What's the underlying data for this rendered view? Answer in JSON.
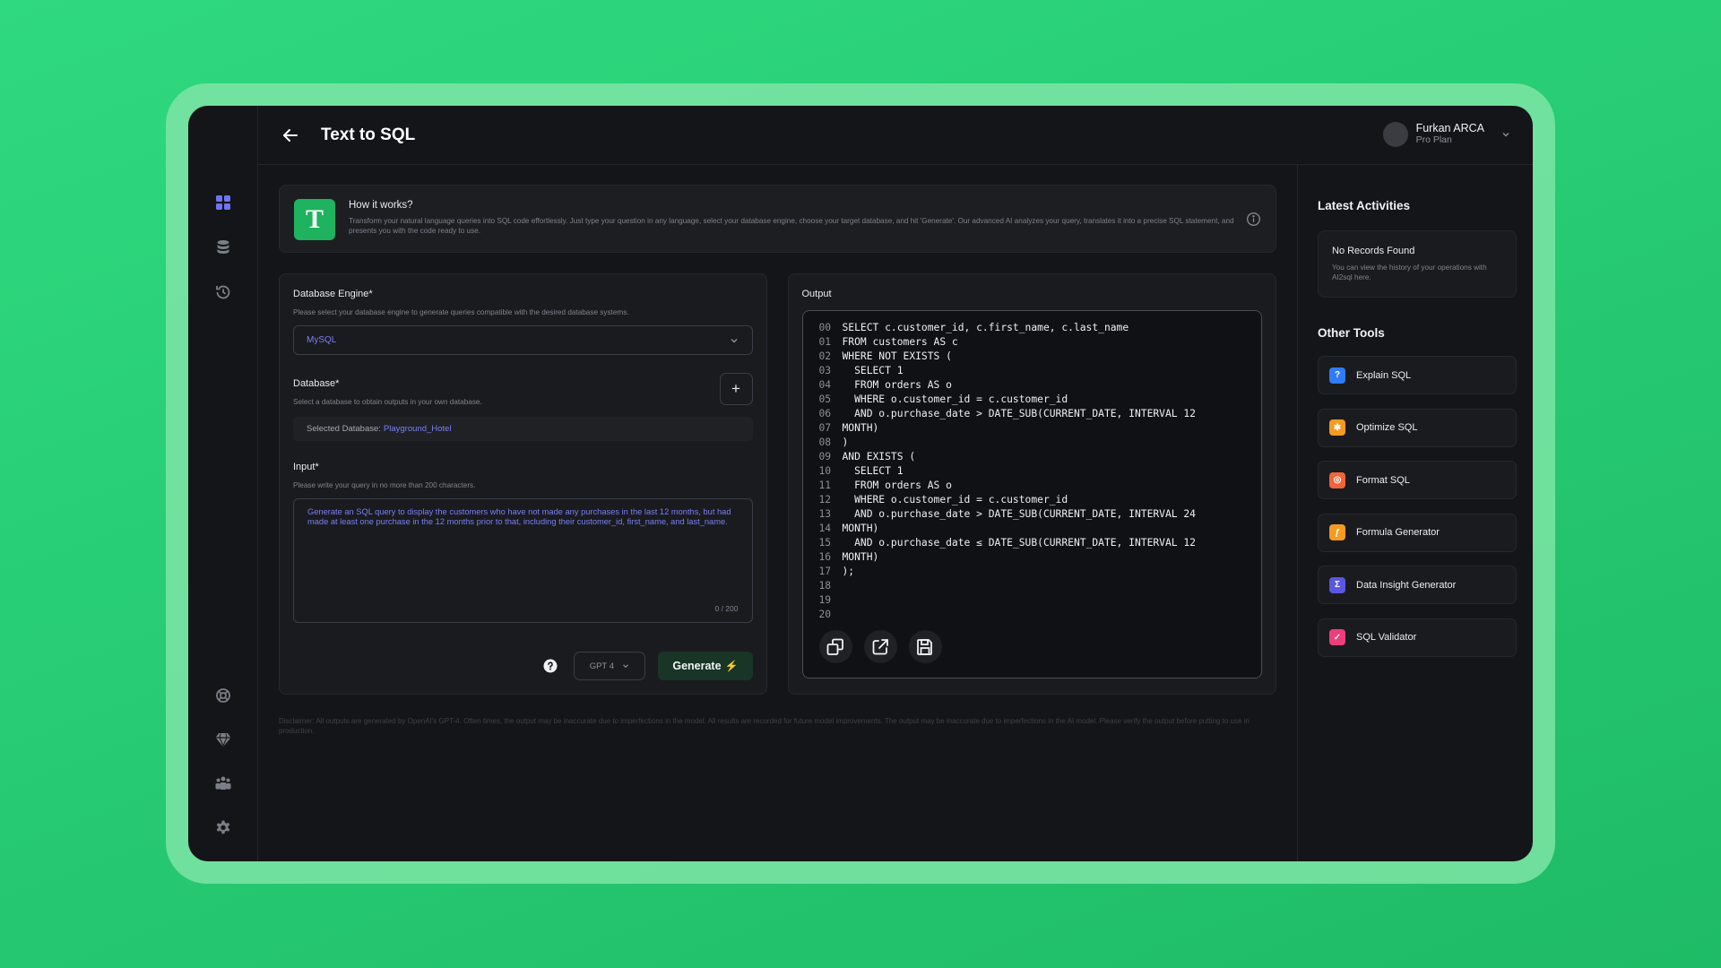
{
  "header": {
    "title": "Text to SQL",
    "user_name": "Furkan ARCA",
    "user_plan": "Pro Plan"
  },
  "how": {
    "logo_letter": "T",
    "title": "How it works?",
    "description": "Transform your natural language queries into SQL code effortlessly. Just type your question in any language, select your database engine, choose your target database, and hit 'Generate'. Our advanced AI analyzes your query, translates it into a precise SQL statement, and presents you with the code ready to use."
  },
  "form": {
    "engine_label": "Database Engine*",
    "engine_hint": "Please select your database engine to generate queries compatible with the desired database systems.",
    "engine_value": "MySQL",
    "database_label": "Database*",
    "database_hint": "Select a database to obtain outputs in your own database.",
    "selected_db_prefix": "Selected Database:",
    "selected_db_name": "Playground_Hotel",
    "add_label": "+",
    "input_label": "Input*",
    "input_hint": "Please write your query in no more than 200 characters.",
    "input_value": "Generate an SQL query to display the customers who have not made any purchases in the last 12 months, but had made at least one purchase in the 12 months prior to that, including their customer_id, first_name, and last_name.",
    "counter": "0 / 200",
    "model": "GPT 4",
    "generate_label": "Generate",
    "generate_icon": "⚡"
  },
  "output": {
    "label": "Output",
    "lines": [
      {
        "n": "00",
        "code": "SELECT c.customer_id, c.first_name, c.last_name"
      },
      {
        "n": "01",
        "code": "FROM customers AS c"
      },
      {
        "n": "02",
        "code": "WHERE NOT EXISTS ("
      },
      {
        "n": "03",
        "code": "  SELECT 1"
      },
      {
        "n": "04",
        "code": "  FROM orders AS o"
      },
      {
        "n": "05",
        "code": "  WHERE o.customer_id = c.customer_id"
      },
      {
        "n": "06",
        "code": "  AND o.purchase_date > DATE_SUB(CURRENT_DATE, INTERVAL 12"
      },
      {
        "n": "07",
        "code": "MONTH)"
      },
      {
        "n": "08",
        "code": ")"
      },
      {
        "n": "09",
        "code": "AND EXISTS ("
      },
      {
        "n": "10",
        "code": "  SELECT 1"
      },
      {
        "n": "11",
        "code": "  FROM orders AS o"
      },
      {
        "n": "12",
        "code": "  WHERE o.customer_id = c.customer_id"
      },
      {
        "n": "13",
        "code": "  AND o.purchase_date > DATE_SUB(CURRENT_DATE, INTERVAL 24"
      },
      {
        "n": "14",
        "code": "MONTH)"
      },
      {
        "n": "15",
        "code": "  AND o.purchase_date ≤ DATE_SUB(CURRENT_DATE, INTERVAL 12"
      },
      {
        "n": "16",
        "code": "MONTH)"
      },
      {
        "n": "17",
        "code": ");"
      },
      {
        "n": "18",
        "code": ""
      },
      {
        "n": "19",
        "code": ""
      },
      {
        "n": "20",
        "code": ""
      }
    ]
  },
  "disclaimer": "Disclaimer: All outputs are generated by OpenAI's GPT-4. Often times, the output may be inaccurate due to imperfections in the model. All results are recorded for future model improvements. The output may be inaccurate due to imperfections in the AI model. Please verify the output before putting to use in production.",
  "right": {
    "activities_title": "Latest Activities",
    "no_records_title": "No Records Found",
    "no_records_desc": "You can view the history of your operations with AI2sql here.",
    "tools_title": "Other Tools",
    "tools": [
      {
        "name": "Explain SQL",
        "color": "#2f7cf6",
        "glyph": "?"
      },
      {
        "name": "Optimize SQL",
        "color": "#f59a23",
        "glyph": "✱"
      },
      {
        "name": "Format SQL",
        "color": "#f0643a",
        "glyph": "◎"
      },
      {
        "name": "Formula Generator",
        "color": "#f59a23",
        "glyph": "ƒ"
      },
      {
        "name": "Data Insight Generator",
        "color": "#5b57e0",
        "glyph": "Σ"
      },
      {
        "name": "SQL Validator",
        "color": "#ec3f7a",
        "glyph": "✓"
      }
    ]
  },
  "colors": {
    "accent": "#7b7ff5",
    "brand": "#1fb25f",
    "background": "#141518"
  }
}
